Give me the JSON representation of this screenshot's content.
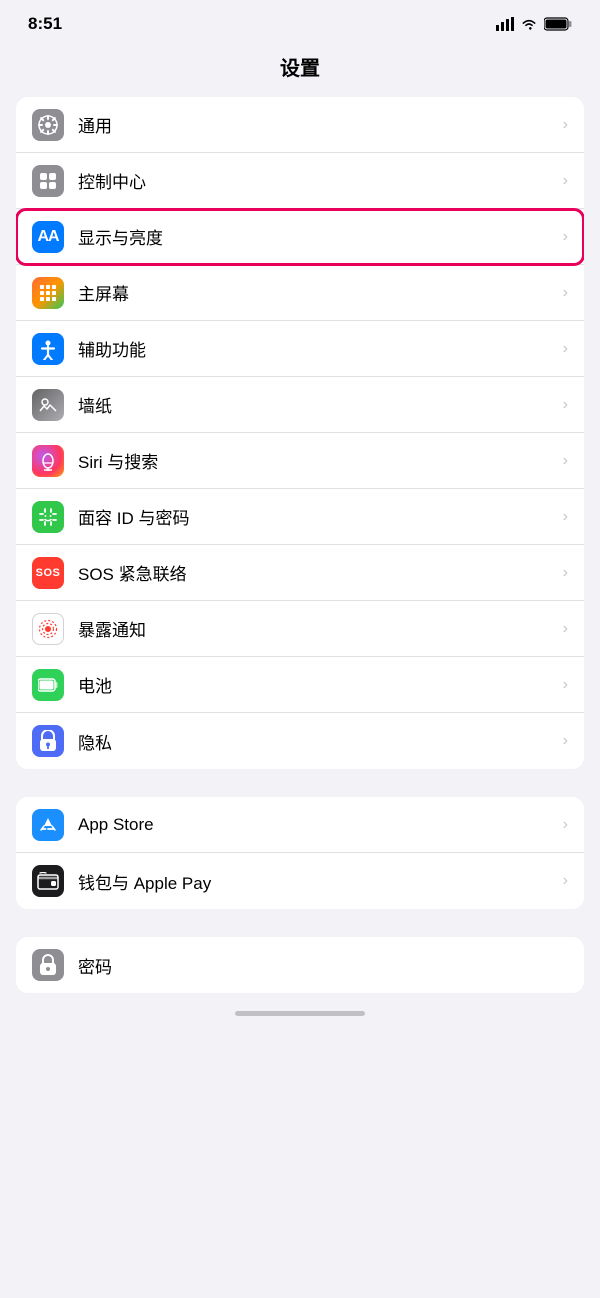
{
  "statusBar": {
    "time": "8:51",
    "signal": "signal-icon",
    "wifi": "wifi-icon",
    "battery": "battery-icon"
  },
  "pageTitle": "设置",
  "group1": {
    "items": [
      {
        "id": "general",
        "label": "通用",
        "iconBg": "icon-gray",
        "iconType": "gear"
      },
      {
        "id": "control-center",
        "label": "控制中心",
        "iconBg": "icon-gray2",
        "iconType": "toggle"
      },
      {
        "id": "display",
        "label": "显示与亮度",
        "iconBg": "icon-blue",
        "iconType": "aa",
        "highlighted": true
      },
      {
        "id": "homescreen",
        "label": "主屏幕",
        "iconBg": "icon-colorful",
        "iconType": "grid"
      },
      {
        "id": "accessibility",
        "label": "辅助功能",
        "iconBg": "icon-teal",
        "iconType": "person"
      },
      {
        "id": "wallpaper",
        "label": "墙纸",
        "iconBg": "icon-silver",
        "iconType": "flower"
      },
      {
        "id": "siri",
        "label": "Siri 与搜索",
        "iconBg": "icon-siri",
        "iconType": "siri"
      },
      {
        "id": "faceid",
        "label": "面容 ID 与密码",
        "iconBg": "icon-green",
        "iconType": "face"
      },
      {
        "id": "sos",
        "label": "SOS 紧急联络",
        "iconBg": "icon-red",
        "iconType": "sos"
      },
      {
        "id": "exposure",
        "label": "暴露通知",
        "iconBg": "icon-exposure",
        "iconType": "exposure"
      },
      {
        "id": "battery",
        "label": "电池",
        "iconBg": "icon-battery",
        "iconType": "battery"
      },
      {
        "id": "privacy",
        "label": "隐私",
        "iconBg": "icon-privacy",
        "iconType": "hand"
      }
    ]
  },
  "group2": {
    "items": [
      {
        "id": "appstore",
        "label": "App Store",
        "iconBg": "icon-appstore",
        "iconType": "appstore"
      },
      {
        "id": "wallet",
        "label": "钱包与 Apple Pay",
        "iconBg": "icon-wallet",
        "iconType": "wallet"
      }
    ]
  },
  "group3": {
    "items": [
      {
        "id": "password",
        "label": "密码",
        "iconBg": "icon-password",
        "iconType": "key"
      }
    ]
  },
  "chevron": "›"
}
